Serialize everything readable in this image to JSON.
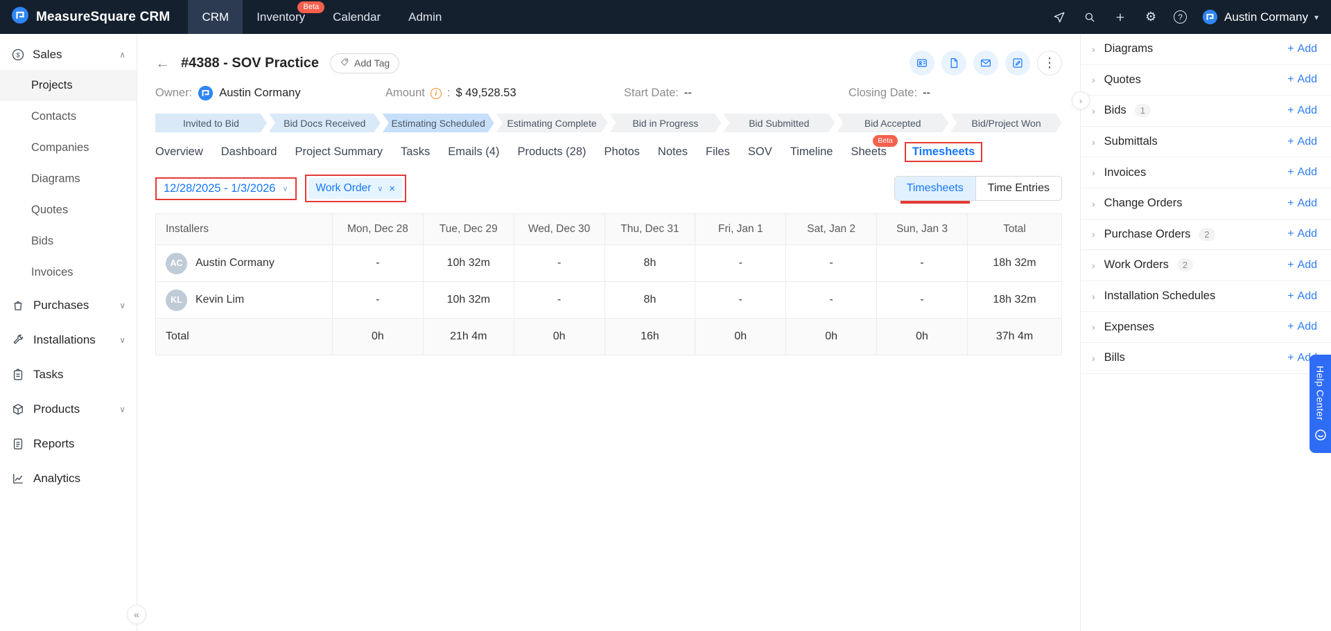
{
  "colors": {
    "navbar_bg": "#15202f",
    "accent_blue": "#1677ff",
    "accent_light_blue": "#e6f4ff",
    "beta_red": "#f5604d",
    "stage_done": "#d9e9f8",
    "stage_current": "#c7dff8",
    "stage_todo": "#eff1f3",
    "annotation_red": "#e53935",
    "help_tab_blue": "#2f6cf6"
  },
  "icons": {
    "back": "←",
    "collapse": "«",
    "chevron_right": "›",
    "chevron_down": "∨",
    "chevron_up": "∧",
    "caret_down": "▾",
    "close": "×",
    "plus": "+",
    "more": "⋮",
    "question": "?",
    "gear": "⚙",
    "info": "i"
  },
  "navbar": {
    "brand": "MeasureSquare CRM",
    "items": [
      {
        "label": "CRM"
      },
      {
        "label": "Inventory",
        "badge": "Beta"
      },
      {
        "label": "Calendar"
      },
      {
        "label": "Admin"
      }
    ],
    "user_name": "Austin Cormany"
  },
  "sidebar": {
    "sales_label": "Sales",
    "sales_items": [
      "Projects",
      "Contacts",
      "Companies",
      "Diagrams",
      "Quotes",
      "Bids",
      "Invoices"
    ],
    "groups": [
      "Purchases",
      "Installations",
      "Tasks",
      "Products",
      "Reports",
      "Analytics"
    ]
  },
  "project": {
    "title": "#4388 - SOV Practice",
    "add_tag_label": "Add Tag",
    "owner_label": "Owner:",
    "owner_name": "Austin Cormany",
    "amount_label": "Amount",
    "amount_colon": ":",
    "amount_value": "$ 49,528.53",
    "start_date_label": "Start Date:",
    "start_date_value": "--",
    "closing_date_label": "Closing Date:",
    "closing_date_value": "--"
  },
  "stages": [
    {
      "label": "Invited to Bid",
      "state": "done"
    },
    {
      "label": "Bid Docs Received",
      "state": "done"
    },
    {
      "label": "Estimating Scheduled",
      "state": "current"
    },
    {
      "label": "Estimating Complete",
      "state": "todo"
    },
    {
      "label": "Bid in Progress",
      "state": "todo"
    },
    {
      "label": "Bid Submitted",
      "state": "todo"
    },
    {
      "label": "Bid Accepted",
      "state": "todo"
    },
    {
      "label": "Bid/Project Won",
      "state": "todo"
    }
  ],
  "tabs": [
    {
      "label": "Overview"
    },
    {
      "label": "Dashboard"
    },
    {
      "label": "Project Summary"
    },
    {
      "label": "Tasks"
    },
    {
      "label": "Emails (4)"
    },
    {
      "label": "Products (28)"
    },
    {
      "label": "Photos"
    },
    {
      "label": "Notes"
    },
    {
      "label": "Files"
    },
    {
      "label": "SOV"
    },
    {
      "label": "Timeline"
    },
    {
      "label": "Sheets",
      "badge": "Beta"
    },
    {
      "label": "Timesheets",
      "active": true
    }
  ],
  "timesheets": {
    "date_range": "12/28/2025 - 1/3/2026",
    "filter_chip": "Work Order",
    "toggle_left": "Timesheets",
    "toggle_right": "Time Entries",
    "table": {
      "columns": [
        "Installers",
        "Mon, Dec 28",
        "Tue, Dec 29",
        "Wed, Dec 30",
        "Thu, Dec 31",
        "Fri, Jan 1",
        "Sat, Jan 2",
        "Sun, Jan 3",
        "Total"
      ],
      "rows": [
        {
          "initials": "AC",
          "name": "Austin Cormany",
          "values": [
            "-",
            "10h 32m",
            "-",
            "8h",
            "-",
            "-",
            "-",
            "18h 32m"
          ]
        },
        {
          "initials": "KL",
          "name": "Kevin Lim",
          "values": [
            "-",
            "10h 32m",
            "-",
            "8h",
            "-",
            "-",
            "-",
            "18h 32m"
          ]
        }
      ],
      "total": {
        "label": "Total",
        "values": [
          "0h",
          "21h 4m",
          "0h",
          "16h",
          "0h",
          "0h",
          "0h",
          "37h 4m"
        ]
      }
    }
  },
  "right_panel": {
    "add_label": "Add",
    "sections": [
      {
        "label": "Diagrams"
      },
      {
        "label": "Quotes"
      },
      {
        "label": "Bids",
        "count": "1"
      },
      {
        "label": "Submittals"
      },
      {
        "label": "Invoices"
      },
      {
        "label": "Change Orders"
      },
      {
        "label": "Purchase Orders",
        "count": "2"
      },
      {
        "label": "Work Orders",
        "count": "2"
      },
      {
        "label": "Installation Schedules"
      },
      {
        "label": "Expenses"
      },
      {
        "label": "Bills"
      }
    ],
    "help_center": "Help Center"
  }
}
